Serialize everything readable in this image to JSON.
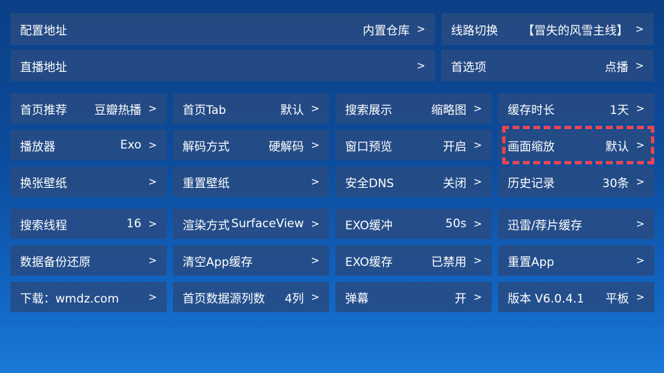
{
  "top": [
    [
      {
        "label": "配置地址",
        "value": "内置仓库"
      },
      {
        "label": "线路切换",
        "value": "【冒失的风雪主线】"
      }
    ],
    [
      {
        "label": "直播地址",
        "value": ""
      },
      {
        "label": "首选项",
        "value": "点播"
      }
    ]
  ],
  "grid": [
    [
      {
        "label": "首页推荐",
        "value": "豆瓣热播"
      },
      {
        "label": "首页Tab",
        "value": "默认"
      },
      {
        "label": "搜索展示",
        "value": "缩略图"
      },
      {
        "label": "缓存时长",
        "value": "1天"
      }
    ],
    [
      {
        "label": "播放器",
        "value": "Exo"
      },
      {
        "label": "解码方式",
        "value": "硬解码"
      },
      {
        "label": "窗口预览",
        "value": "开启"
      },
      {
        "label": "画面缩放",
        "value": "默认"
      }
    ],
    [
      {
        "label": "换张壁纸",
        "value": ""
      },
      {
        "label": "重置壁纸",
        "value": ""
      },
      {
        "label": "安全DNS",
        "value": "关闭"
      },
      {
        "label": "历史记录",
        "value": "30条"
      }
    ],
    [
      {
        "label": "搜索线程",
        "value": "16"
      },
      {
        "label": "渲染方式",
        "value": "SurfaceView"
      },
      {
        "label": "EXO缓冲",
        "value": "50s"
      },
      {
        "label": "迅雷/荐片缓存",
        "value": ""
      }
    ],
    [
      {
        "label": "数据备份还原",
        "value": ""
      },
      {
        "label": "清空App缓存",
        "value": ""
      },
      {
        "label": "EXO缓存",
        "value": "已禁用"
      },
      {
        "label": "重置App",
        "value": ""
      }
    ],
    [
      {
        "label": "下载：wmdz.com",
        "value": ""
      },
      {
        "label": "首页数据源列数",
        "value": "4列"
      },
      {
        "label": "弹幕",
        "value": "开"
      },
      {
        "label": "版本 V6.0.4.1",
        "value": "平板"
      }
    ]
  ],
  "chevron": ">",
  "highlight_color": "#e8464e"
}
